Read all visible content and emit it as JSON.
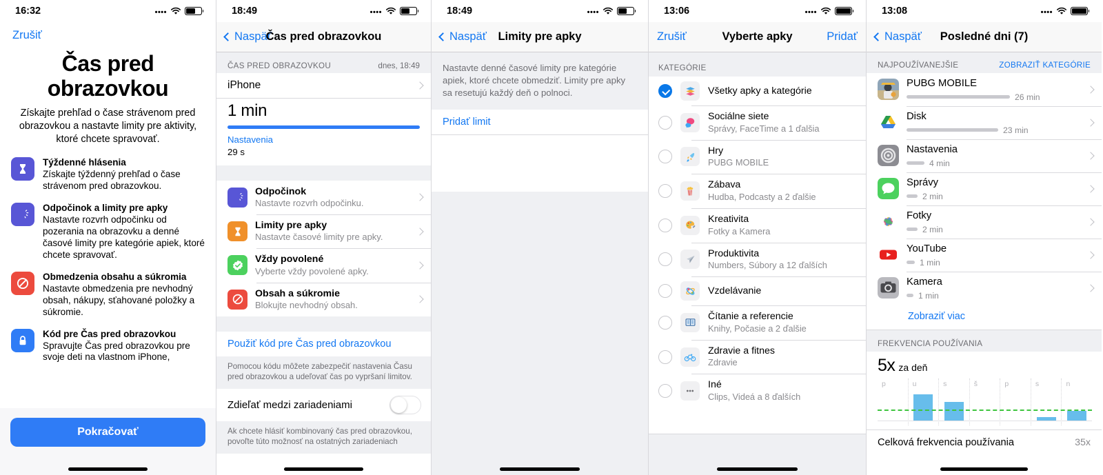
{
  "panel1": {
    "status": {
      "time": "16:32",
      "wifi": "wifi-icon",
      "battery_pct": 62
    },
    "cancel_label": "Zrušiť",
    "title": "Čas pred obrazovkou",
    "lede": "Získajte prehľad o čase strávenom pred obrazovkou a nastavte limity pre aktivity, ktoré chcete spravovať.",
    "features": [
      {
        "icon": "hourglass-icon",
        "color": "#5856d6",
        "title": "Týždenné hlásenia",
        "desc": "Získajte týždenný prehľad o čase strávenom pred obrazovkou."
      },
      {
        "icon": "moon-downtime-icon",
        "color": "#5856d6",
        "title": "Odpočinok a limity pre apky",
        "desc": "Nastavte rozvrh odpočinku od pozerania na obrazovku a denné časové limity pre kategórie apiek, ktoré chcete spravovať."
      },
      {
        "icon": "no-entry-icon",
        "color": "#ec4b3e",
        "title": "Obmedzenia obsahu a súkromia",
        "desc": "Nastavte obmedzenia pre nevhodný obsah, nákupy, sťahované položky a súkromie."
      },
      {
        "icon": "lock-icon",
        "color": "#2f7cf6",
        "title": "Kód pre Čas pred obrazovkou",
        "desc": "Spravujte Čas pred obrazovkou pre svoje deti na vlastnom iPhone,"
      }
    ],
    "cta_label": "Pokračovať"
  },
  "panel2": {
    "status": {
      "time": "18:49",
      "battery_pct": 55
    },
    "back_label": "Naspäť",
    "title": "Čas pred obrazovkou",
    "group_header": {
      "left": "ČAS PRED OBRAZOVKOU",
      "right": "dnes, 18:49"
    },
    "device_row": "iPhone",
    "usage": {
      "total": "1 min",
      "app_name": "Nastavenia",
      "app_time": "29 s",
      "bar_pct": 100
    },
    "items": [
      {
        "icon": "moon-downtime-icon",
        "color": "#5856d6",
        "title": "Odpočinok",
        "desc": "Nastavte rozvrh odpočinku."
      },
      {
        "icon": "hourglass-icon",
        "color": "#f0902a",
        "title": "Limity pre apky",
        "desc": "Nastavte časové limity pre apky."
      },
      {
        "icon": "check-badge-icon",
        "color": "#4cd15e",
        "title": "Vždy povolené",
        "desc": "Vyberte vždy povolené apky."
      },
      {
        "icon": "no-entry-icon",
        "color": "#ec4b3e",
        "title": "Obsah a súkromie",
        "desc": "Blokujte nevhodný obsah."
      }
    ],
    "passcode_link": "Použiť kód pre Čas pred obrazovkou",
    "passcode_note": "Pomocou kódu môžete zabezpečiť nastavenia Času pred obrazovkou a udeľovať čas po vypršaní limitov.",
    "share_toggle": {
      "label": "Zdieľať medzi zariadeniami",
      "on": false
    },
    "share_note": "Ak chcete hlásiť kombinovaný čas pred obrazovkou, povoľte túto možnosť na ostatných zariadeniach"
  },
  "panel3": {
    "status": {
      "time": "18:49",
      "battery_pct": 55
    },
    "back_label": "Naspäť",
    "title": "Limity pre apky",
    "description": "Nastavte denné časové limity pre kategórie apiek, ktoré chcete obmedziť. Limity pre apky sa resetujú každý deň o polnoci.",
    "add_limit_label": "Pridať limit"
  },
  "panel4": {
    "status": {
      "time": "13:06",
      "battery_pct": 100
    },
    "cancel_label": "Zrušiť",
    "title": "Vyberte apky",
    "add_label": "Pridať",
    "group_header": "KATEGÓRIE",
    "categories": [
      {
        "selected": true,
        "icon": "stack-icon",
        "name": "Všetky apky a kategórie",
        "sub": ""
      },
      {
        "selected": false,
        "icon": "social-icon",
        "name": "Sociálne siete",
        "sub": "Správy, FaceTime a 1 ďalšia"
      },
      {
        "selected": false,
        "icon": "rocket-icon",
        "name": "Hry",
        "sub": "PUBG MOBILE"
      },
      {
        "selected": false,
        "icon": "popcorn-icon",
        "name": "Zábava",
        "sub": "Hudba, Podcasty a 2 ďalšie"
      },
      {
        "selected": false,
        "icon": "palette-icon",
        "name": "Kreativita",
        "sub": "Fotky a Kamera"
      },
      {
        "selected": false,
        "icon": "paperplane-icon",
        "name": "Produktivita",
        "sub": "Numbers, Súbory a 12 ďalších"
      },
      {
        "selected": false,
        "icon": "atom-icon",
        "name": "Vzdelávanie",
        "sub": ""
      },
      {
        "selected": false,
        "icon": "book-icon",
        "name": "Čítanie a referencie",
        "sub": "Knihy, Počasie a 2 ďalšie"
      },
      {
        "selected": false,
        "icon": "bicycle-icon",
        "name": "Zdravie a fitnes",
        "sub": "Zdravie"
      },
      {
        "selected": false,
        "icon": "ellipsis-icon",
        "name": "Iné",
        "sub": "Clips, Videá a 8 ďalších"
      }
    ]
  },
  "panel5": {
    "status": {
      "time": "13:08",
      "battery_pct": 100
    },
    "back_label": "Naspäť",
    "title": "Posledné dni (7)",
    "group_header": {
      "left": "NAJPOUŽÍVANEJŠIE",
      "right": "ZOBRAZIŤ KATEGÓRIE"
    },
    "apps": [
      {
        "icon": "pubg-icon",
        "name": "PUBG MOBILE",
        "time": "26 min",
        "bar_pct": 100
      },
      {
        "icon": "drive-icon",
        "name": "Disk",
        "time": "23 min",
        "bar_pct": 88
      },
      {
        "icon": "settings-icon",
        "name": "Nastavenia",
        "time": "4 min",
        "bar_pct": 17
      },
      {
        "icon": "messages-icon",
        "name": "Správy",
        "time": "2 min",
        "bar_pct": 9
      },
      {
        "icon": "photos-icon",
        "name": "Fotky",
        "time": "2 min",
        "bar_pct": 9
      },
      {
        "icon": "youtube-icon",
        "name": "YouTube",
        "time": "1 min",
        "bar_pct": 6
      },
      {
        "icon": "camera-icon",
        "name": "Kamera",
        "time": "1 min",
        "bar_pct": 5
      }
    ],
    "show_more_label": "Zobraziť viac",
    "freq_header": "FREKVENCIA POUŽÍVANIA",
    "freq_value": "5x",
    "freq_unit": "za deň",
    "total_label": "Celková frekvencia používania",
    "total_value": "35x"
  },
  "chart_data": {
    "type": "bar",
    "title": "Frekvencia používania",
    "categories": [
      "p",
      "u",
      "s",
      "š",
      "p",
      "s",
      "n"
    ],
    "values": [
      0,
      13,
      9,
      0,
      0,
      2,
      5
    ],
    "average": 5,
    "average_line_label": "5x za deň",
    "xlabel": "",
    "ylabel": "",
    "ylim": [
      0,
      14
    ],
    "grid": true,
    "legend": "none",
    "series_color": "#67bdeb",
    "average_color": "#3ec53e",
    "total": "35x"
  }
}
